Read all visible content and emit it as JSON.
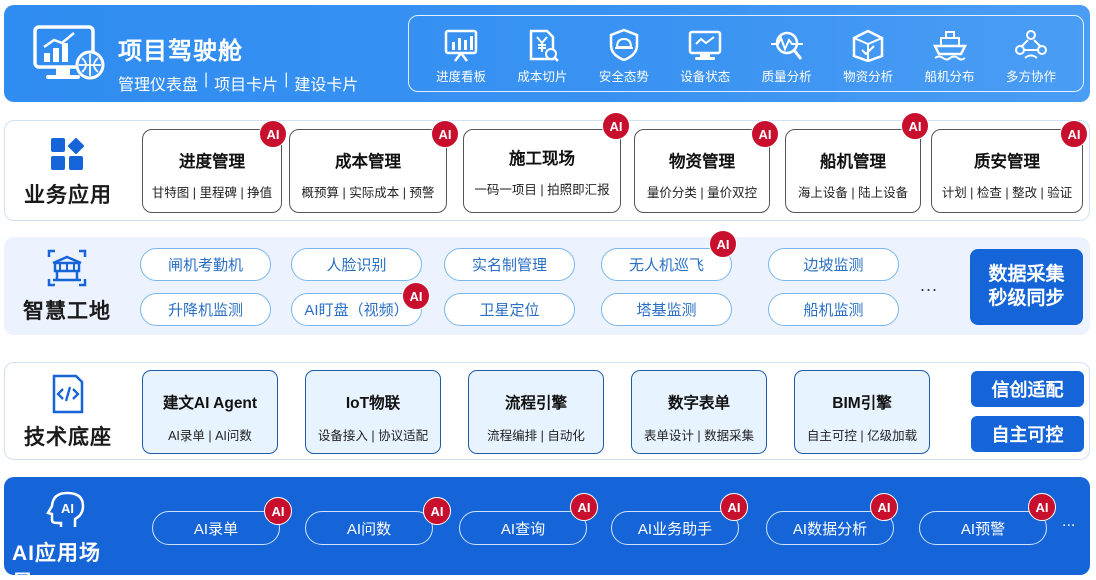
{
  "cockpit": {
    "title": "项目驾驶舱",
    "links": [
      "管理仪表盘",
      "项目卡片",
      "建设卡片"
    ],
    "separator": "|",
    "menu": [
      {
        "label": "进度看板",
        "icon": "progress-board-icon"
      },
      {
        "label": "成本切片",
        "icon": "cost-slice-icon"
      },
      {
        "label": "安全态势",
        "icon": "safety-shield-icon"
      },
      {
        "label": "设备状态",
        "icon": "device-monitor-icon"
      },
      {
        "label": "质量分析",
        "icon": "quality-search-icon"
      },
      {
        "label": "物资分析",
        "icon": "materials-box-icon"
      },
      {
        "label": "船机分布",
        "icon": "ship-icon"
      },
      {
        "label": "多方协作",
        "icon": "collaboration-icon"
      }
    ]
  },
  "business": {
    "title": "业务应用",
    "badge": "AI",
    "cards": [
      {
        "name": "进度管理",
        "sub": "甘特图 | 里程碑 | 挣值"
      },
      {
        "name": "成本管理",
        "sub": "概预算 | 实际成本 | 预警"
      },
      {
        "name": "施工现场",
        "sub": "一码一项目 | 拍照即汇报"
      },
      {
        "name": "物资管理",
        "sub": "量价分类 | 量价双控"
      },
      {
        "name": "船机管理",
        "sub": "海上设备 | 陆上设备"
      },
      {
        "name": "质安管理",
        "sub": "计划 | 检查 | 整改 | 验证"
      }
    ]
  },
  "smart_site": {
    "title": "智慧工地",
    "items_row1": [
      "闸机考勤机",
      "人脸识别",
      "实名制管理",
      "无人机巡飞",
      "边坡监测"
    ],
    "items_row2": [
      "升降机监测",
      "AI盯盘（视频）",
      "卫星定位",
      "塔基监测",
      "船机监测"
    ],
    "ellipsis": "...",
    "sync_line1": "数据采集",
    "sync_line2": "秒级同步"
  },
  "tech": {
    "title": "技术底座",
    "cards": [
      {
        "name": "建文AI Agent",
        "sub": "AI录单 | AI问数"
      },
      {
        "name": "IoT物联",
        "sub": "设备接入 | 协议适配"
      },
      {
        "name": "流程引擎",
        "sub": "流程编排 | 自动化"
      },
      {
        "name": "数字表单",
        "sub": "表单设计 | 数据采集"
      },
      {
        "name": "BIM引擎",
        "sub": "自主可控 | 亿级加载"
      }
    ],
    "buttons": [
      "信创适配",
      "自主可控"
    ]
  },
  "ai_scenes": {
    "title": "AI应用场景",
    "items": [
      "AI录单",
      "AI问数",
      "AI查询",
      "AI业务助手",
      "AI数据分析",
      "AI预警"
    ],
    "ellipsis": "..."
  },
  "colors": {
    "banner": "#2f8cf0",
    "primary": "#1565d8",
    "badge": "#c8102e",
    "pill_text": "#2a6fc4",
    "pill_border": "#79b7ec"
  }
}
